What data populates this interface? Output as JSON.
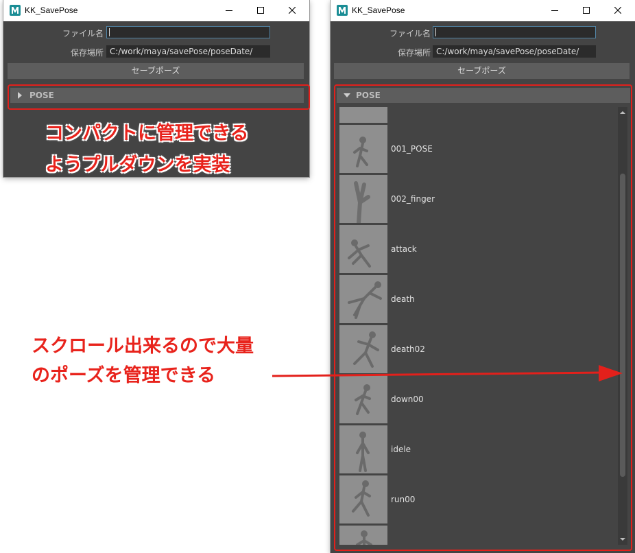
{
  "windows": {
    "left": {
      "title": "KK_SavePose",
      "filename_label": "ファイル名",
      "filename_value": "",
      "location_label": "保存場所",
      "location_value": "C:/work/maya/savePose/poseDate/",
      "save_button": "セーブポーズ",
      "frame_label": "POSE",
      "frame_expanded": false
    },
    "right": {
      "title": "KK_SavePose",
      "filename_label": "ファイル名",
      "filename_value": "",
      "location_label": "保存場所",
      "location_value": "C:/work/maya/savePose/poseDate/",
      "save_button": "セーブポーズ",
      "frame_label": "POSE",
      "frame_expanded": true,
      "poses": [
        {
          "name": ""
        },
        {
          "name": "001_POSE"
        },
        {
          "name": "002_finger"
        },
        {
          "name": "attack"
        },
        {
          "name": "death"
        },
        {
          "name": "death02"
        },
        {
          "name": "down00"
        },
        {
          "name": "idele"
        },
        {
          "name": "run00"
        },
        {
          "name": ""
        }
      ]
    }
  },
  "annotations": {
    "collapse_line1": "コンパクトに管理できる",
    "collapse_line2": "ようプルダウンを実装",
    "scroll_line1": "スクロール出来るので大量",
    "scroll_line2": "のポーズを管理できる"
  },
  "colors": {
    "annotation_red": "#e3201b",
    "panel_bg": "#444444",
    "field_bg": "#2b2b2b",
    "accent_border": "#5285a6"
  }
}
